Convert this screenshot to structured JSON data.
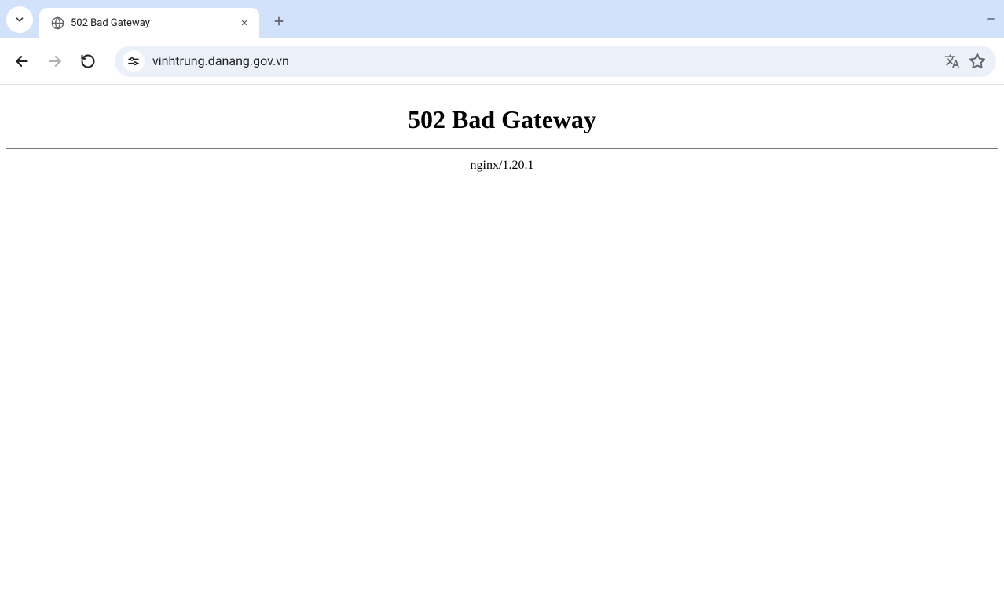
{
  "tab": {
    "title": "502 Bad Gateway"
  },
  "address_bar": {
    "url": "vinhtrung.danang.gov.vn"
  },
  "page": {
    "error_title": "502 Bad Gateway",
    "server_line": "nginx/1.20.1"
  }
}
